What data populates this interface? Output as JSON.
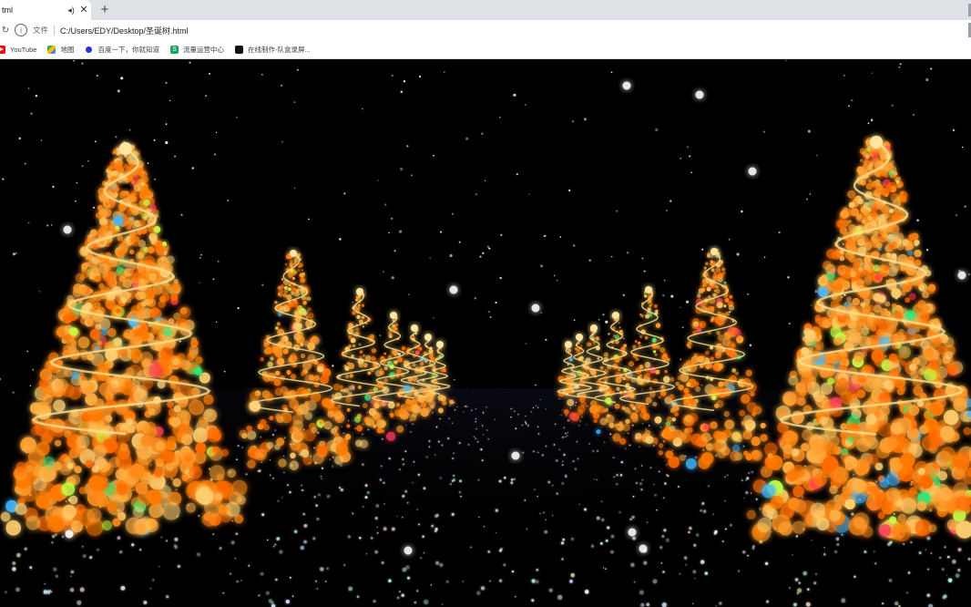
{
  "browser": {
    "tab": {
      "title": "tml",
      "audio_icon": "speaker-icon",
      "close_icon": "close-icon"
    },
    "new_tab_icon": "plus-icon",
    "address": {
      "info_icon": "info-icon",
      "protocol_label": "文件",
      "url": "C:/Users/EDY/Desktop/圣诞树.html"
    },
    "bookmarks": [
      {
        "label": "YouTube",
        "icon": "youtube-icon"
      },
      {
        "label": "地图",
        "icon": "maps-icon"
      },
      {
        "label": "百度一下，你就知道",
        "icon": "baidu-icon"
      },
      {
        "label": "流量运营中心",
        "icon": "flow-icon"
      },
      {
        "label": "在线制作-队盒录屏...",
        "icon": "online-icon"
      }
    ]
  },
  "scene": {
    "description_colors": {
      "tree_glow": "#ff7a00",
      "tree_core": "#ffd27a",
      "background": "#000000",
      "snow": "#ffffff"
    }
  }
}
